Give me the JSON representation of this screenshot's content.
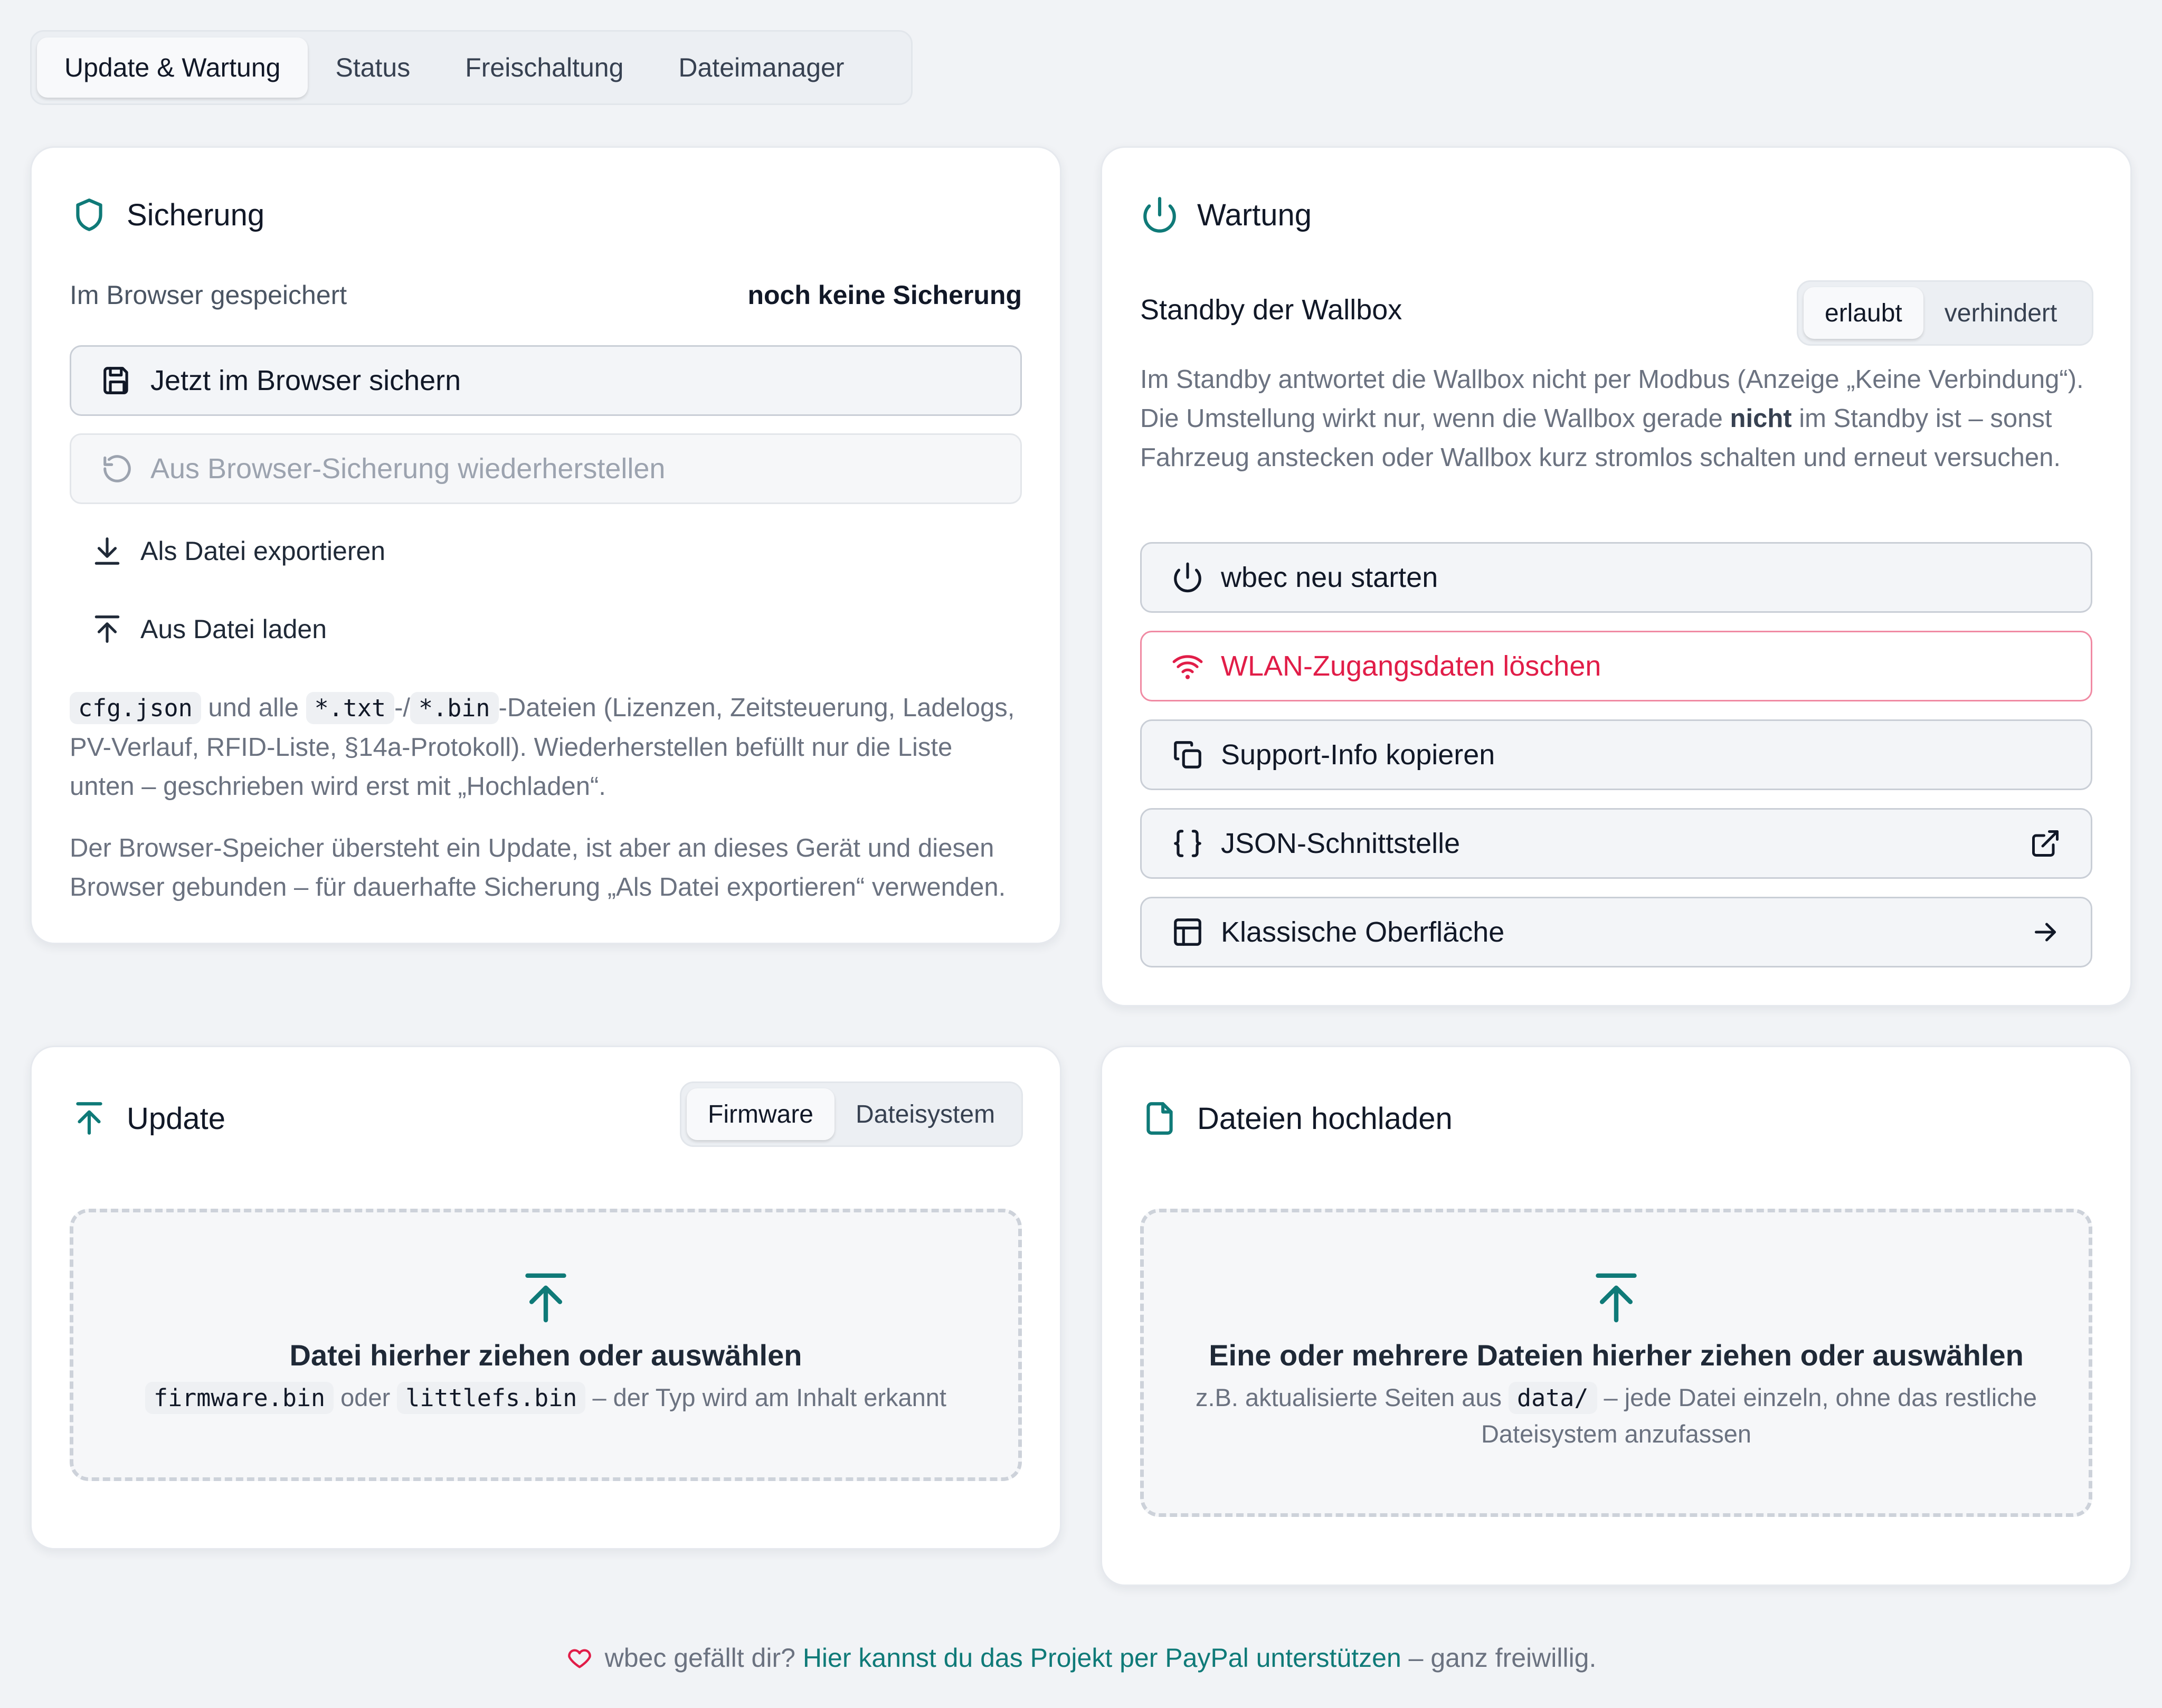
{
  "colors": {
    "accent": "#0f7a78",
    "danger": "#e11d48",
    "background": "#f1f3f6"
  },
  "tabs": [
    {
      "label": "Update & Wartung",
      "active": true
    },
    {
      "label": "Status",
      "active": false
    },
    {
      "label": "Freischaltung",
      "active": false
    },
    {
      "label": "Dateimanager",
      "active": false
    }
  ],
  "sicherung": {
    "title": "Sicherung",
    "icon": "shield-icon",
    "browser_label": "Im Browser gespeichert",
    "browser_value": "noch keine Sicherung",
    "save_button": "Jetzt im Browser sichern",
    "restore_button": "Aus Browser-Sicherung wiederherstellen",
    "export_link": "Als Datei exportieren",
    "load_link": "Aus Datei laden",
    "note1_code1": "cfg.json",
    "note1_text1": " und alle ",
    "note1_code2": "*.txt",
    "note1_text2": "-/",
    "note1_code3": "*.bin",
    "note1_text3": "-Dateien (Lizenzen, Zeitsteuerung, Ladelogs, PV-Verlauf, RFID-Liste, §14a-Protokoll). Wiederherstellen befüllt nur die Liste unten – geschrieben wird erst mit „Hochladen“.",
    "note2": "Der Browser-Speicher übersteht ein Update, ist aber an dieses Gerät und diesen Browser gebunden – für dauerhafte Sicherung „Als Datei exportieren“ verwenden."
  },
  "wartung": {
    "title": "Wartung",
    "icon": "power-icon",
    "standby_label": "Standby der Wallbox",
    "standby_options": [
      "erlaubt",
      "verhindert"
    ],
    "standby_selected": "erlaubt",
    "desc_part1": "Im Standby antwortet die Wallbox nicht per Modbus (Anzeige „Keine Verbindung“). Die Umstellung wirkt nur, wenn die Wallbox gerade ",
    "desc_bold": "nicht",
    "desc_part2": " im Standby ist – sonst Fahrzeug anstecken oder Wallbox kurz stromlos schalten und erneut versuchen.",
    "restart_button": "wbec neu starten",
    "wifi_reset_button": "WLAN-Zugangsdaten löschen",
    "support_button": "Support-Info kopieren",
    "json_button": "JSON-Schnittstelle",
    "classic_button": "Klassische Oberfläche"
  },
  "update": {
    "title": "Update",
    "options": [
      "Firmware",
      "Dateisystem"
    ],
    "selected": "Firmware",
    "drop_title": "Datei hierher ziehen oder auswählen",
    "drop_code1": "firmware.bin",
    "drop_text1": " oder ",
    "drop_code2": "littlefs.bin",
    "drop_text2": " – der Typ wird am Inhalt erkannt"
  },
  "upload": {
    "title": "Dateien hochladen",
    "drop_title": "Eine oder mehrere Dateien hierher ziehen oder auswählen",
    "drop_text1": "z.B. aktualisierte Seiten aus ",
    "drop_code": "data/",
    "drop_text2": " – jede Datei einzeln, ohne das restliche Dateisystem anzufassen"
  },
  "footer": {
    "text1": "wbec gefällt dir? ",
    "link": "Hier kannst du das Projekt per PayPal unterstützen",
    "text2": " – ganz freiwillig."
  }
}
